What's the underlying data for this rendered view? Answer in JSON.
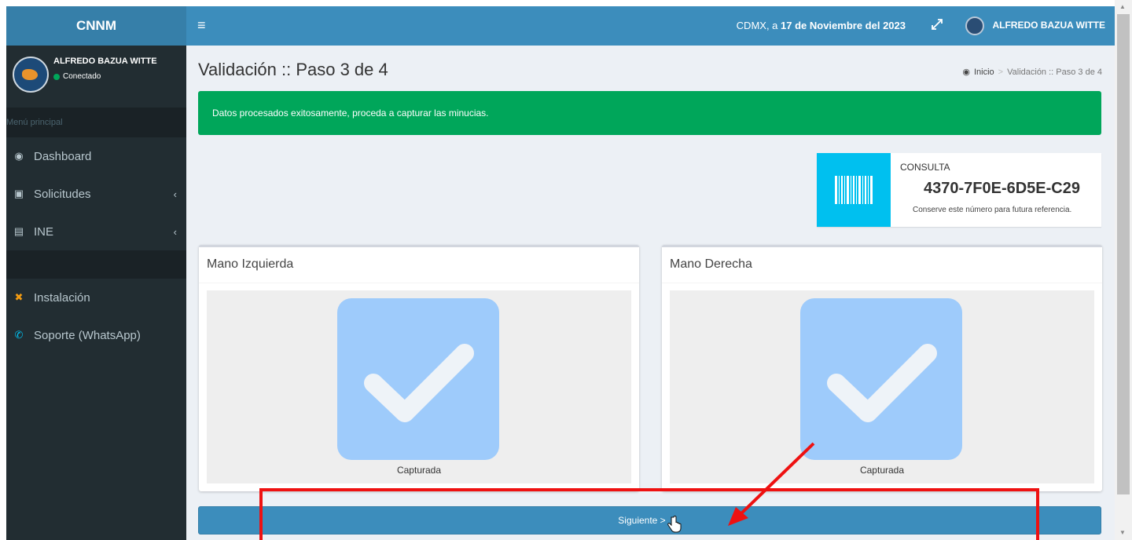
{
  "header": {
    "brand": "CNNM",
    "date_prefix": "CDMX, a ",
    "date_bold": "17 de Noviembre del 2023",
    "user_name": "ALFREDO BAZUA WITTE"
  },
  "sidebar": {
    "user_name": "ALFREDO BAZUA WITTE",
    "status": "Conectado",
    "menu_header": "Menú principal",
    "items": [
      {
        "label": "Dashboard",
        "icon": "dashboard-icon"
      },
      {
        "label": "Solicitudes",
        "icon": "archive-icon"
      },
      {
        "label": "INE",
        "icon": "id-card-icon"
      },
      {
        "label": "Instalación",
        "icon": "wrench-icon"
      },
      {
        "label": "Soporte (WhatsApp)",
        "icon": "whatsapp-icon"
      }
    ]
  },
  "page": {
    "title": "Validación :: Paso 3 de 4",
    "breadcrumb_home": "Inicio",
    "breadcrumb_current": "Validación :: Paso 3 de 4"
  },
  "alert": {
    "message": "Datos procesados exitosamente, proceda a capturar las minucias."
  },
  "consulta": {
    "label": "CONSULTA",
    "number": "4370-7F0E-6D5E-C29",
    "note": "Conserve este número para futura referencia."
  },
  "hands": {
    "left": {
      "title": "Mano Izquierda",
      "status": "Capturada"
    },
    "right": {
      "title": "Mano Derecha",
      "status": "Capturada"
    }
  },
  "actions": {
    "next_label": "Siguiente >"
  },
  "colors": {
    "topbar": "#3c8dbc",
    "sidebar": "#222d32",
    "success": "#00a65a",
    "info": "#00c0ef",
    "check_tile": "#9ecbfb",
    "highlight": "#ee1111"
  }
}
